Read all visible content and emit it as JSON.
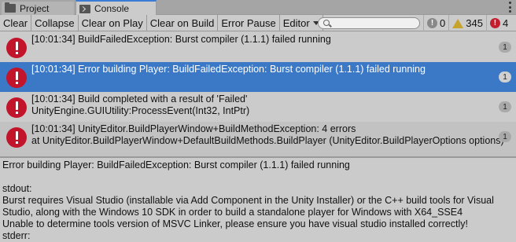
{
  "tabs": [
    {
      "label": "Project",
      "icon": "folder-icon"
    },
    {
      "label": "Console",
      "icon": "console-icon"
    }
  ],
  "toolbar": {
    "clear": "Clear",
    "collapse": "Collapse",
    "clear_on_play": "Clear on Play",
    "clear_on_build": "Clear on Build",
    "error_pause": "Error Pause",
    "editor": "Editor",
    "search_placeholder": "",
    "info_count": "0",
    "warning_count": "345",
    "error_count": "4"
  },
  "logs": [
    {
      "line1": "[10:01:34] BuildFailedException: Burst compiler (1.1.1) failed running",
      "line2": "",
      "count": "1",
      "selected": false
    },
    {
      "line1": "[10:01:34] Error building Player: BuildFailedException: Burst compiler (1.1.1) failed running",
      "line2": "",
      "count": "1",
      "selected": true
    },
    {
      "line1": "[10:01:34] Build completed with a result of 'Failed'",
      "line2": "UnityEngine.GUIUtility:ProcessEvent(Int32, IntPtr)",
      "count": "1",
      "selected": false
    },
    {
      "line1": "[10:01:34] UnityEditor.BuildPlayerWindow+BuildMethodException: 4 errors",
      "line2": "  at UnityEditor.BuildPlayerWindow+DefaultBuildMethods.BuildPlayer (UnityEditor.BuildPlayerOptions options)",
      "count": "1",
      "selected": false
    }
  ],
  "detail": {
    "line1": "Error building Player: BuildFailedException: Burst compiler (1.1.1) failed running",
    "line2": "stdout:",
    "line3": "Burst requires Visual Studio (installable via Add Component in the Unity Installer) or the C++ build tools for Visual",
    "line4": "Studio, along with the Windows 10 SDK in order to build a standalone player for Windows with X64_SSE4",
    "line5": "Unable to determine tools version of MSVC Linker, please ensure you have visual studio installed correctly!",
    "line6": "stderr:"
  },
  "colors": {
    "selection": "#3b78c6",
    "error": "#c2142a",
    "warning": "#c7a32c",
    "active_tab_accent": "#3a7bd5"
  }
}
